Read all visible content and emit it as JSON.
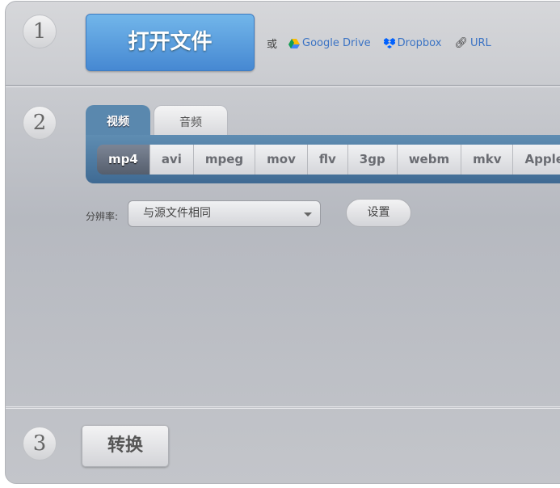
{
  "step1": {
    "number": "1",
    "open_label": "打开文件",
    "or": "或",
    "links": [
      {
        "label": "Google Drive",
        "icon": "google-drive-icon"
      },
      {
        "label": "Dropbox",
        "icon": "dropbox-icon"
      },
      {
        "label": "URL",
        "icon": "link-icon"
      }
    ]
  },
  "step2": {
    "number": "2",
    "tabs": [
      {
        "label": "视频",
        "active": true
      },
      {
        "label": "音频",
        "active": false
      }
    ],
    "formats": [
      "mp4",
      "avi",
      "mpeg",
      "mov",
      "flv",
      "3gp",
      "webm",
      "mkv",
      "Apple"
    ],
    "selected_format": "mp4",
    "resolution_label": "分辨率:",
    "resolution_value": "与源文件相同",
    "settings_label": "设置"
  },
  "step3": {
    "number": "3",
    "convert_label": "转换"
  },
  "colors": {
    "accent": "#4688d2",
    "tab_bar": "#5a88ae"
  }
}
